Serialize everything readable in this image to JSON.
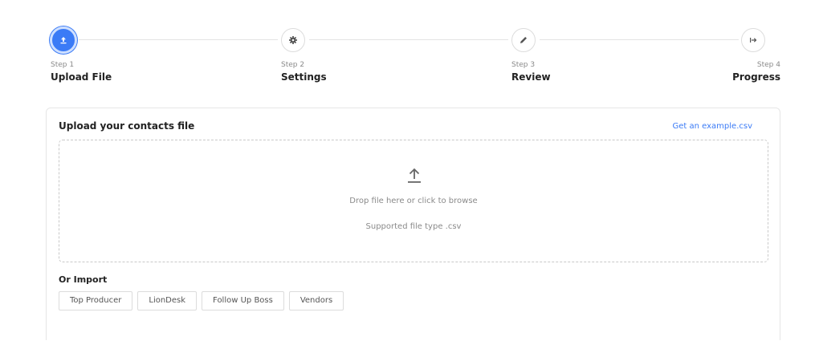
{
  "stepper": {
    "steps": [
      {
        "num": "Step 1",
        "title": "Upload File",
        "icon": "upload-icon",
        "active": true
      },
      {
        "num": "Step 2",
        "title": "Settings",
        "icon": "gear-icon",
        "active": false
      },
      {
        "num": "Step 3",
        "title": "Review",
        "icon": "pencil-icon",
        "active": false
      },
      {
        "num": "Step 4",
        "title": "Progress",
        "icon": "arrow-to-right-icon",
        "active": false
      }
    ]
  },
  "upload": {
    "title": "Upload your contacts file",
    "example_link": "Get an example.csv",
    "drop_text": "Drop file here or click to browse",
    "supported_text": "Supported file type .csv"
  },
  "import": {
    "title": "Or Import",
    "options": [
      "Top Producer",
      "LionDesk",
      "Follow Up Boss",
      "Vendors"
    ]
  },
  "colors": {
    "accent": "#3b7bf6",
    "border": "#e6e6e6",
    "muted_text": "#8a8a8a"
  }
}
